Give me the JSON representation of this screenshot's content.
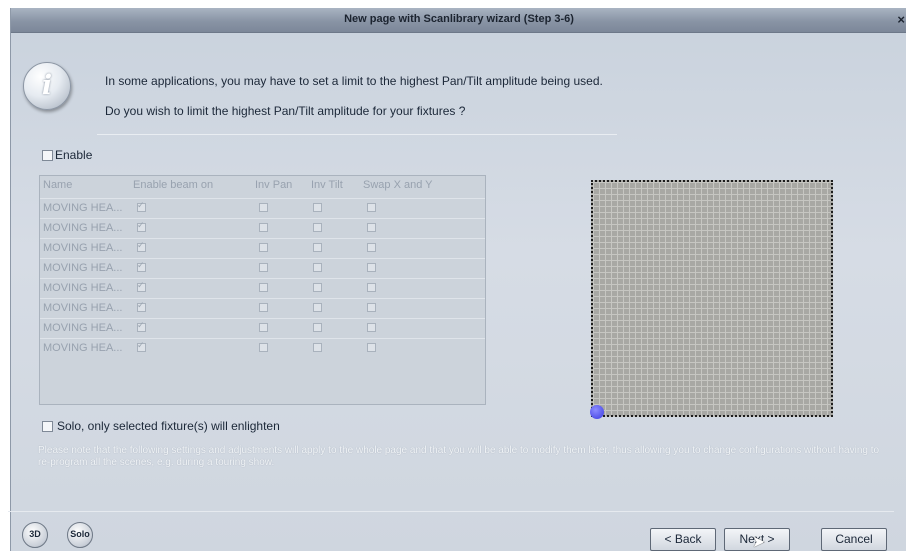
{
  "window": {
    "title": "New page with Scanlibrary wizard (Step 3-6)",
    "close_glyph": "×"
  },
  "info": {
    "icon_glyph": "i",
    "line1": "In some applications, you may have to set a limit to the highest Pan/Tilt amplitude being used.",
    "line2": "Do you wish to limit the highest Pan/Tilt amplitude for your fixtures ?"
  },
  "enable": {
    "label": "Enable",
    "checked": false
  },
  "table": {
    "columns": [
      "Name",
      "Enable beam on",
      "Inv Pan",
      "Inv Tilt",
      "Swap X and Y"
    ],
    "rows": [
      {
        "name": "MOVING HEA...",
        "enable_beam": true,
        "inv_pan": false,
        "inv_tilt": false,
        "swap_xy": false
      },
      {
        "name": "MOVING HEA...",
        "enable_beam": true,
        "inv_pan": false,
        "inv_tilt": false,
        "swap_xy": false
      },
      {
        "name": "MOVING HEA...",
        "enable_beam": true,
        "inv_pan": false,
        "inv_tilt": false,
        "swap_xy": false
      },
      {
        "name": "MOVING HEA...",
        "enable_beam": true,
        "inv_pan": false,
        "inv_tilt": false,
        "swap_xy": false
      },
      {
        "name": "MOVING HEA...",
        "enable_beam": true,
        "inv_pan": false,
        "inv_tilt": false,
        "swap_xy": false
      },
      {
        "name": "MOVING HEA...",
        "enable_beam": true,
        "inv_pan": false,
        "inv_tilt": false,
        "swap_xy": false
      },
      {
        "name": "MOVING HEA...",
        "enable_beam": true,
        "inv_pan": false,
        "inv_tilt": false,
        "swap_xy": false
      },
      {
        "name": "MOVING HEA...",
        "enable_beam": true,
        "inv_pan": false,
        "inv_tilt": false,
        "swap_xy": false
      }
    ]
  },
  "solo": {
    "label": "Solo, only selected fixture(s) will enlighten",
    "checked": false
  },
  "note": "Please note that the following settings and adjustments will apply to the whole page and that you will be able to modify them later, thus allowing you to change configurations without having to re-program all the scenes, e.g. during a touring show.",
  "bottom": {
    "btn_3d": "3D",
    "btn_solo": "Solo",
    "back": "< Back",
    "next": "Next >",
    "cancel": "Cancel"
  },
  "colors": {
    "window_bg": "#d6dce5",
    "titlebar": "#8994a5",
    "pan_tilt_marker": "#3b3be0",
    "grid_bg": "#a8a8a4"
  }
}
